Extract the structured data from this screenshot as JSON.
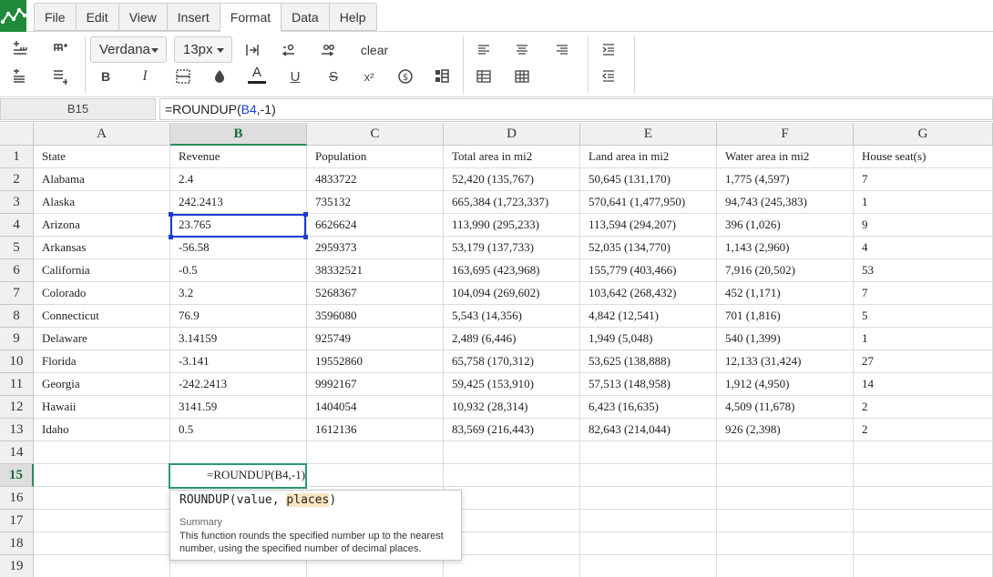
{
  "menu": {
    "items": [
      "File",
      "Edit",
      "View",
      "Insert",
      "Format",
      "Data",
      "Help"
    ],
    "active": "Format"
  },
  "toolbar": {
    "font_family": "Verdana",
    "font_size": "13px",
    "clear_label": "clear",
    "accent": "#1e8a3a"
  },
  "formula_bar": {
    "cell_ref": "B15",
    "formula_prefix": "=ROUNDUP(",
    "formula_ref": "B4",
    "formula_suffix": ",-1)"
  },
  "columns": [
    "A",
    "B",
    "C",
    "D",
    "E",
    "F",
    "G"
  ],
  "rows": [
    "1",
    "2",
    "3",
    "4",
    "5",
    "6",
    "7",
    "8",
    "9",
    "10",
    "11",
    "12",
    "13",
    "14",
    "15",
    "16",
    "17",
    "18",
    "19"
  ],
  "cells": [
    [
      "State",
      "Revenue",
      "Population",
      "Total area in mi2",
      "Land area in mi2",
      "Water area in mi2",
      "House seat(s)"
    ],
    [
      "Alabama",
      "2.4",
      "4833722",
      "52,420 (135,767)",
      "50,645 (131,170)",
      "1,775 (4,597)",
      "7"
    ],
    [
      "Alaska",
      "242.2413",
      "735132",
      "665,384 (1,723,337)",
      "570,641 (1,477,950)",
      "94,743 (245,383)",
      "1"
    ],
    [
      "Arizona",
      "23.765",
      "6626624",
      "113,990 (295,233)",
      "113,594 (294,207)",
      "396 (1,026)",
      "9"
    ],
    [
      "Arkansas",
      "-56.58",
      "2959373",
      "53,179 (137,733)",
      "52,035 (134,770)",
      "1,143 (2,960)",
      "4"
    ],
    [
      "California",
      "-0.5",
      "38332521",
      "163,695 (423,968)",
      "155,779 (403,466)",
      "7,916 (20,502)",
      "53"
    ],
    [
      "Colorado",
      "3.2",
      "5268367",
      "104,094 (269,602)",
      "103,642 (268,432)",
      "452 (1,171)",
      "7"
    ],
    [
      "Connecticut",
      "76.9",
      "3596080",
      "5,543 (14,356)",
      "4,842 (12,541)",
      "701 (1,816)",
      "5"
    ],
    [
      "Delaware",
      "3.14159",
      "925749",
      "2,489 (6,446)",
      "1,949 (5,048)",
      "540 (1,399)",
      "1"
    ],
    [
      "Florida",
      "-3.141",
      "19552860",
      "65,758 (170,312)",
      "53,625 (138,888)",
      "12,133 (31,424)",
      "27"
    ],
    [
      "Georgia",
      "-242.2413",
      "9992167",
      "59,425 (153,910)",
      "57,513 (148,958)",
      "1,912 (4,950)",
      "14"
    ],
    [
      "Hawaii",
      "3141.59",
      "1404054",
      "10,932 (28,314)",
      "6,423 (16,635)",
      "4,509 (11,678)",
      "2"
    ],
    [
      "Idaho",
      "0.5",
      "1612136",
      "83,569 (216,443)",
      "82,643 (214,044)",
      "926 (2,398)",
      "2"
    ]
  ],
  "editing_cell": {
    "text": "=ROUNDUP(B4,-1)"
  },
  "tooltip": {
    "sig_fn": "ROUNDUP(",
    "sig_arg1": "value, ",
    "sig_arg2": "places",
    "sig_close": ")",
    "summary_label": "Summary",
    "description": "This function rounds the specified number up to the nearest number, using the specified number of decimal places."
  },
  "colors": {
    "selection": "#1a3bd6",
    "edit_border": "#2a9a6a",
    "header_selected": "#1a6b3a"
  }
}
